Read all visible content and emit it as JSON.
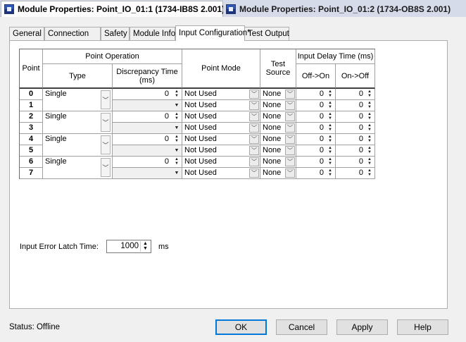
{
  "window": {
    "tabs": [
      {
        "label": "Module Properties: Point_IO_01:1 (1734-IB8S 2.001)",
        "active": true,
        "close": "✕"
      },
      {
        "label": "Module Properties: Point_IO_01:2 (1734-OB8S 2.001)",
        "active": false
      }
    ]
  },
  "property_tabs": [
    "General",
    "Connection",
    "Safety",
    "Module Info",
    "Input Configuration*",
    "Test Output"
  ],
  "active_tab": "Input Configuration*",
  "table": {
    "headers": {
      "point": "Point",
      "point_operation": "Point Operation",
      "type": "Type",
      "discrepancy": "Discrepancy Time (ms)",
      "point_mode": "Point Mode",
      "test_source": "Test Source",
      "input_delay": "Input Delay Time (ms)",
      "off_on": "Off->On",
      "on_off": "On->Off"
    },
    "pairs": [
      {
        "type": "Single",
        "discrepancy": "0"
      },
      {
        "type": "Single",
        "discrepancy": "0"
      },
      {
        "type": "Single",
        "discrepancy": "0"
      },
      {
        "type": "Single",
        "discrepancy": "0"
      }
    ],
    "rows": [
      {
        "point": "0",
        "mode": "Not Used",
        "test_source": "None",
        "off_on": "0",
        "on_off": "0"
      },
      {
        "point": "1",
        "mode": "Not Used",
        "test_source": "None",
        "off_on": "0",
        "on_off": "0"
      },
      {
        "point": "2",
        "mode": "Not Used",
        "test_source": "None",
        "off_on": "0",
        "on_off": "0"
      },
      {
        "point": "3",
        "mode": "Not Used",
        "test_source": "None",
        "off_on": "0",
        "on_off": "0"
      },
      {
        "point": "4",
        "mode": "Not Used",
        "test_source": "None",
        "off_on": "0",
        "on_off": "0"
      },
      {
        "point": "5",
        "mode": "Not Used",
        "test_source": "None",
        "off_on": "0",
        "on_off": "0"
      },
      {
        "point": "6",
        "mode": "Not Used",
        "test_source": "None",
        "off_on": "0",
        "on_off": "0"
      },
      {
        "point": "7",
        "mode": "Not Used",
        "test_source": "None",
        "off_on": "0",
        "on_off": "0"
      }
    ]
  },
  "latch": {
    "label": "Input Error Latch Time:",
    "value": "1000",
    "unit": "ms"
  },
  "status": "Status:  Offline",
  "buttons": {
    "ok": "OK",
    "cancel": "Cancel",
    "apply": "Apply",
    "help": "Help"
  }
}
